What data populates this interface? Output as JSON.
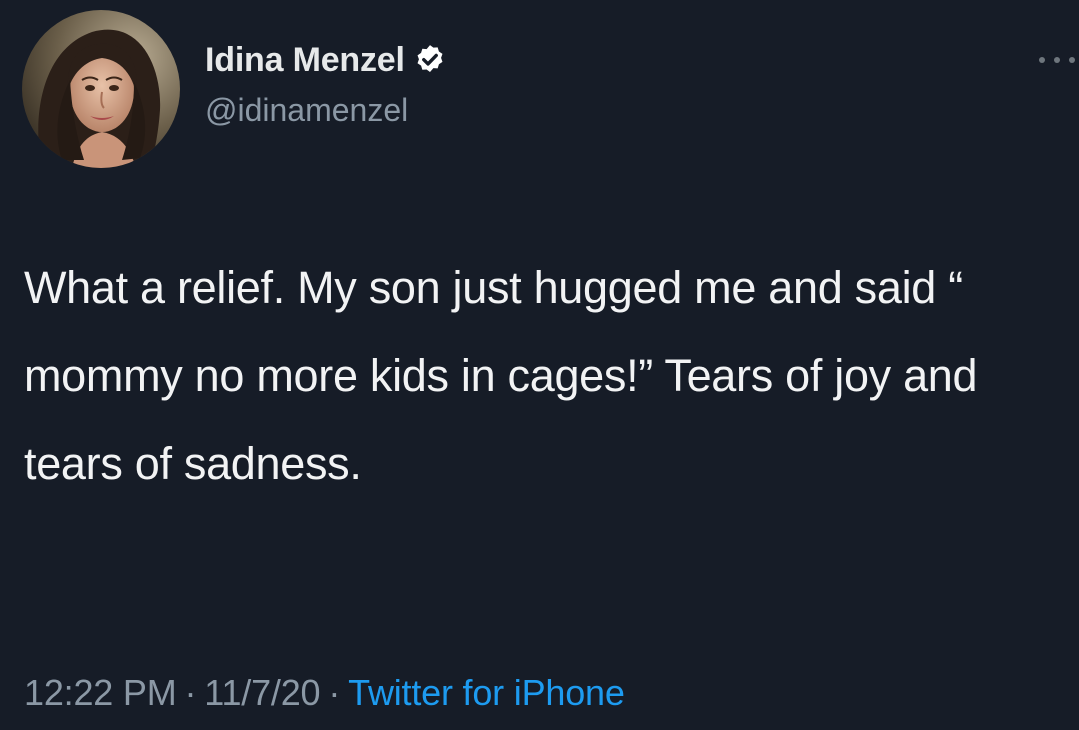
{
  "author": {
    "display_name": "Idina Menzel",
    "handle": "@idinamenzel",
    "verified": true,
    "avatar_icon": "profile-photo",
    "verified_icon": "verified-badge-icon"
  },
  "tweet": {
    "text": "What a relief.  My son just hugged me and said “ mommy no more kids in cages!” Tears of joy and tears of sadness."
  },
  "meta": {
    "time": "12:22 PM",
    "separator": "·",
    "date": "11/7/20",
    "source": "Twitter for iPhone"
  },
  "actions": {
    "more_icon": "more-options-icon"
  },
  "colors": {
    "background": "#161c27",
    "text": "#f2f3f4",
    "muted": "#8b98a5",
    "link": "#1d9bf0"
  }
}
